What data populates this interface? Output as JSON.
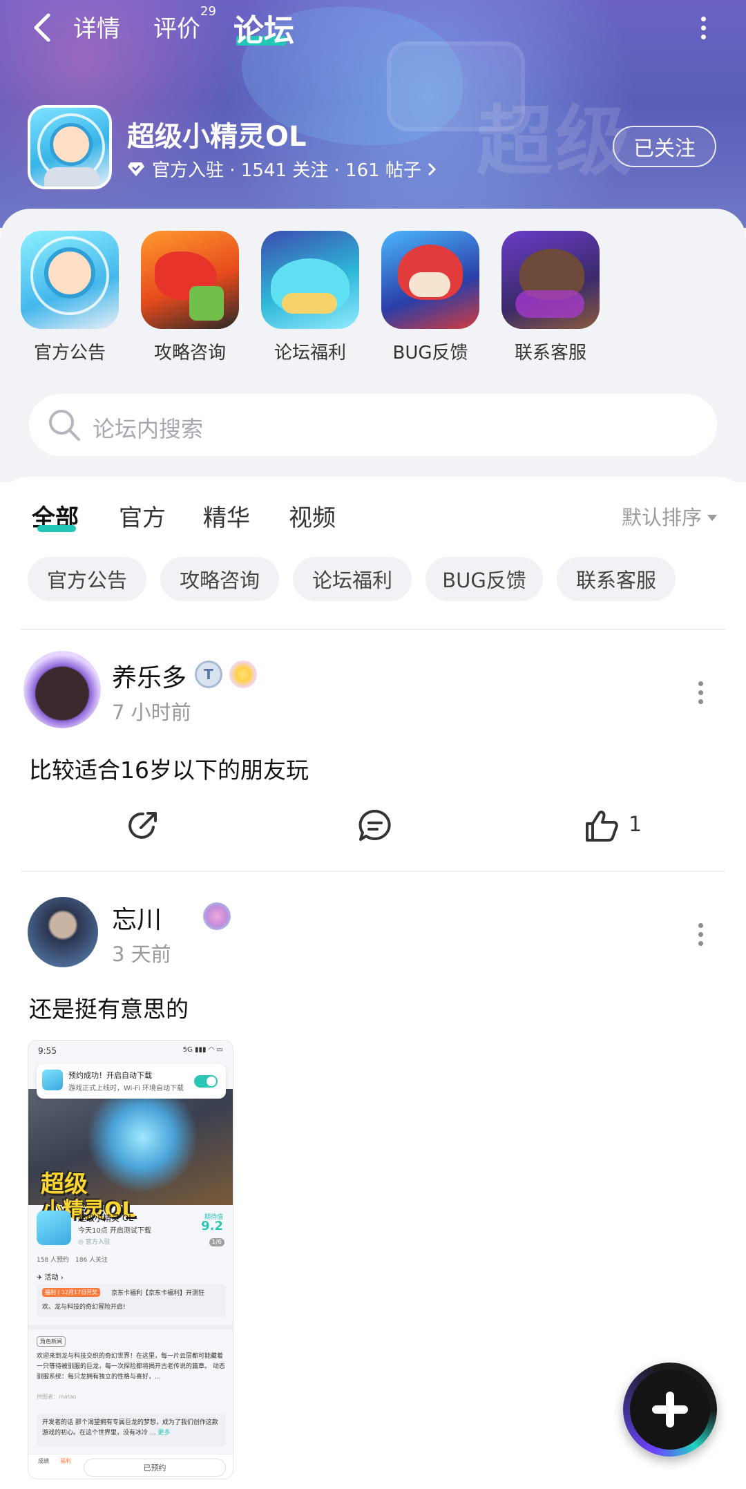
{
  "nav": {
    "tabs": [
      {
        "label": "详情"
      },
      {
        "label": "评价",
        "badge": "29"
      },
      {
        "label": "论坛"
      }
    ],
    "active_tab": "论坛"
  },
  "game": {
    "title": "超级小精灵OL",
    "meta": "官方入驻 · 1541 关注 · 161 帖子",
    "follow_label": "已关注",
    "banner_text": "超级"
  },
  "categories": [
    {
      "label": "官方公告",
      "icon": "category-announcement-icon"
    },
    {
      "label": "攻略咨询",
      "icon": "category-guide-icon"
    },
    {
      "label": "论坛福利",
      "icon": "category-welfare-icon"
    },
    {
      "label": "BUG反馈",
      "icon": "category-bug-icon"
    },
    {
      "label": "联系客服",
      "icon": "category-service-icon"
    }
  ],
  "search": {
    "placeholder": "论坛内搜索"
  },
  "feed_tabs": [
    {
      "label": "全部"
    },
    {
      "label": "官方"
    },
    {
      "label": "精华"
    },
    {
      "label": "视频"
    }
  ],
  "sort_label": "默认排序",
  "chips": [
    "官方公告",
    "攻略咨询",
    "论坛福利",
    "BUG反馈",
    "联系客服"
  ],
  "posts": [
    {
      "user": "养乐多",
      "badge": "T",
      "time": "7 小时前",
      "text": "比较适合16岁以下的朋友玩",
      "likes": "1"
    },
    {
      "user": "忘川",
      "time": "3 天前",
      "text": "还是挺有意思的"
    }
  ],
  "embed": {
    "status_time": "9:55",
    "status_right": "5G ▮▮▮ ◠ ▭",
    "toast_title": "预约成功！开启自动下载",
    "toast_sub": "游戏正式上线时，Wi-Fi 环境自动下载",
    "banner_title_1": "超级",
    "banner_title_2": "小精灵OL",
    "pager": "1/6",
    "app_name": "超级小精灵 OL",
    "app_sub": "今天10点 开启测试下载",
    "app_official": "◎ 官方入驻",
    "score_label": "期待值",
    "score": "9.2",
    "stats": "158 人预约　186 人关注",
    "activity_label": "✈ 活动 ›",
    "activity_tag": "福利 | 12月17日开奖",
    "activity_text_1": "京东卡福利【京东卡福利】开测狂",
    "activity_text_2": "欢、龙与科技的奇幻冒险开启!",
    "section_tag": "角色新闻",
    "desc": "欢迎来到龙与科技交织的奇幻世界！在这里，每一片云层都可能藏着一只等待被驯服的巨龙，每一次探险都将揭开古老传说的篇章。 动态驯服系统：每只龙拥有独立的性格与喜好，...",
    "byline": "供图者：matao",
    "dev_text": "开发者的话  那个渴望拥有专属巨龙的梦想，成为了我们创作这款游戏的初心。在这个世界里，没有冰冷 ... ",
    "dev_more": "更多",
    "bottom_1": "成绩",
    "bottom_2": "福利",
    "reserve_label": "已预约"
  },
  "colors": {
    "accent": "#23c6b7",
    "header_bg": "#5e5fbb",
    "panel_bg": "#f2f3f7"
  }
}
